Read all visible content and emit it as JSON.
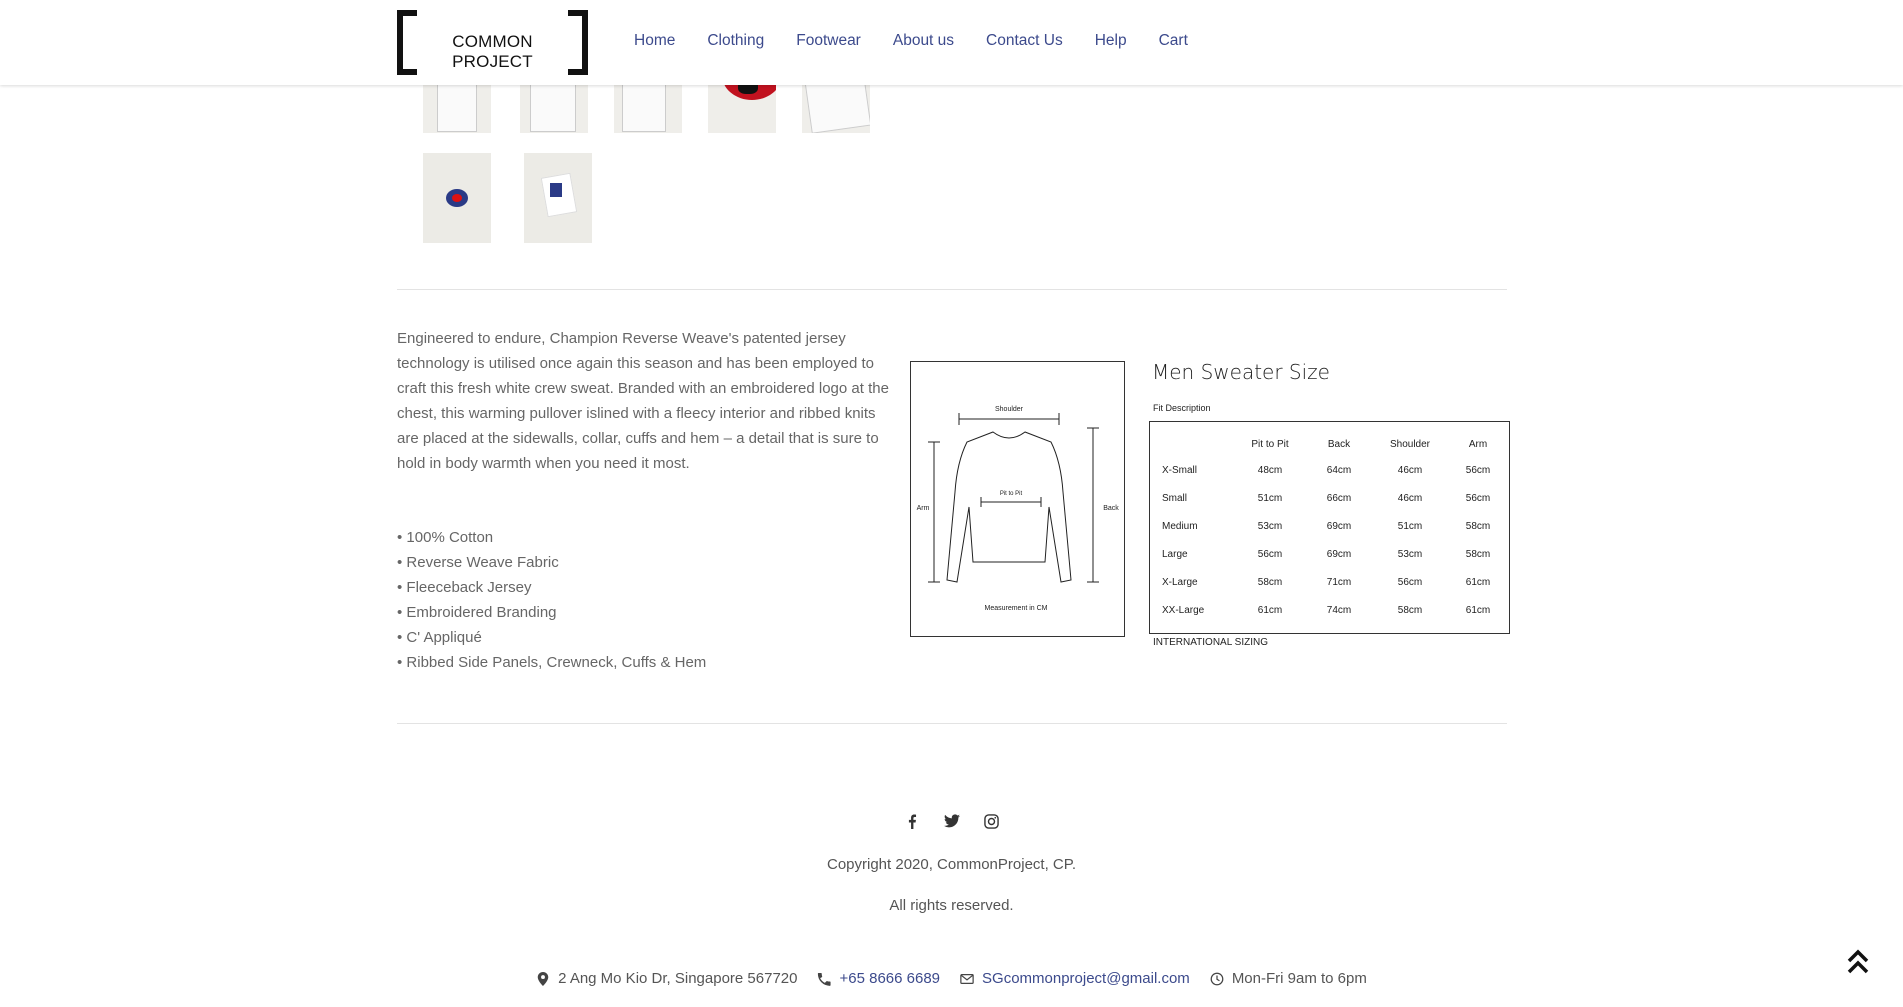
{
  "brand": {
    "logo_text": "COMMON PROJECT"
  },
  "nav": [
    {
      "label": "Home"
    },
    {
      "label": "Clothing"
    },
    {
      "label": "Footwear"
    },
    {
      "label": "About us"
    },
    {
      "label": "Contact Us"
    },
    {
      "label": "Help"
    },
    {
      "label": "Cart"
    }
  ],
  "description": "Engineered to endure, Champion Reverse Weave's patented jersey technology is utilised once again this season and has been employed to craft this fresh white crew sweat. Branded with an embroidered logo at the chest, this warming pullover islined with a fleecy interior and ribbed knits are placed at the sidewalls, collar, cuffs and hem – a detail that is sure to hold in body warmth when you need it most.",
  "features": [
    "• 100% Cotton",
    "• Reverse Weave Fabric",
    "• Fleeceback Jersey",
    "• Embroidered Branding",
    "• C' Appliqué",
    "• Ribbed Side Panels, Crewneck, Cuffs & Hem"
  ],
  "diagram": {
    "shoulder": "Shoulder",
    "pit": "Pit to Pit",
    "arm": "Arm",
    "back": "Back",
    "caption": "Measurement in CM"
  },
  "size_chart": {
    "title": "Men Sweater Size",
    "fit_description": "Fit Description",
    "columns": [
      "",
      "Pit to Pit",
      "Back",
      "Shoulder",
      "Arm"
    ],
    "rows": [
      [
        "X-Small",
        "48cm",
        "64cm",
        "46cm",
        "56cm"
      ],
      [
        "Small",
        "51cm",
        "66cm",
        "46cm",
        "56cm"
      ],
      [
        "Medium",
        "53cm",
        "69cm",
        "51cm",
        "58cm"
      ],
      [
        "Large",
        "56cm",
        "69cm",
        "53cm",
        "58cm"
      ],
      [
        "X-Large",
        "58cm",
        "71cm",
        "56cm",
        "61cm"
      ],
      [
        "XX-Large",
        "61cm",
        "74cm",
        "58cm",
        "61cm"
      ]
    ],
    "footer": "INTERNATIONAL SIZING"
  },
  "footer": {
    "social_icons": [
      "facebook-icon",
      "twitter-icon",
      "instagram-icon"
    ],
    "copyright": "Copyright 2020, CommonProject, CP.",
    "rights": "All rights reserved.",
    "address": "2 Ang Mo Kio Dr, Singapore 567720",
    "phone": "+65 8666 6689",
    "email": "SGcommonproject@gmail.com",
    "hours": "Mon-Fri 9am to 6pm"
  }
}
